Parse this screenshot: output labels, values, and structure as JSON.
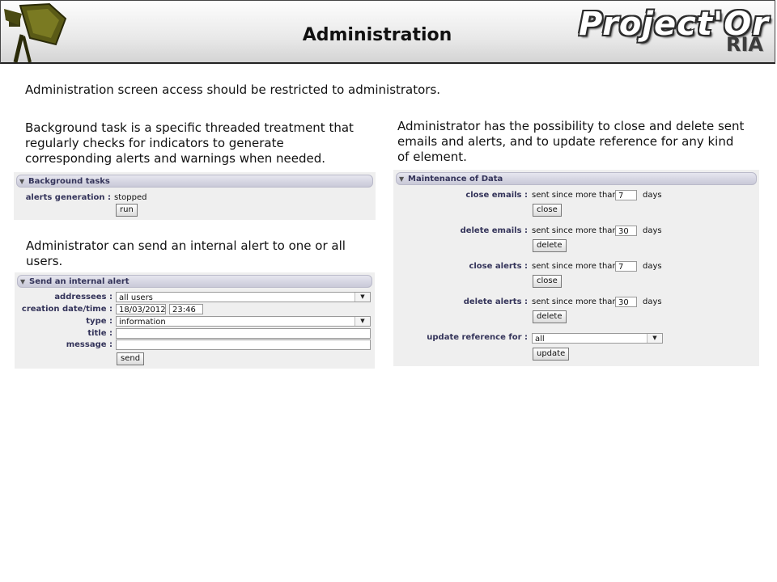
{
  "header": {
    "title": "Administration",
    "brand_name": "Project'Or",
    "brand_suffix": "RIA"
  },
  "intro": "Administration screen access should be restricted to administrators.",
  "background_section": {
    "description": "Background task is a specific threaded treatment that regularly checks for indicators to generate corresponding alerts and warnings when needed.",
    "panel_title": "Background tasks",
    "alerts_generation_label": "alerts generation :",
    "alerts_generation_value": "stopped",
    "run_button": "run"
  },
  "alert_section": {
    "description": "Administrator can send an internal alert to one or all users.",
    "panel_title": "Send an internal alert",
    "addressees_label": "addressees :",
    "addressees_value": "all users",
    "creation_label": "creation date/time :",
    "creation_date": "18/03/2012",
    "creation_time": "23:46",
    "type_label": "type :",
    "type_value": "information",
    "title_label": "title :",
    "title_value": "",
    "message_label": "message :",
    "message_value": "",
    "send_button": "send"
  },
  "maintenance_section": {
    "description": "Administrator has the possibility to close and delete sent emails and alerts, and to update reference for any kind of element.",
    "panel_title": "Maintenance of Data",
    "sent_since_text": "sent since more than",
    "days_text": "days",
    "close_emails": {
      "label": "close emails :",
      "days": "7",
      "button": "close"
    },
    "delete_emails": {
      "label": "delete emails :",
      "days": "30",
      "button": "delete"
    },
    "close_alerts": {
      "label": "close alerts :",
      "days": "7",
      "button": "close"
    },
    "delete_alerts": {
      "label": "delete alerts :",
      "days": "30",
      "button": "delete"
    },
    "update_reference": {
      "label": "update reference for :",
      "value": "all",
      "button": "update"
    }
  }
}
